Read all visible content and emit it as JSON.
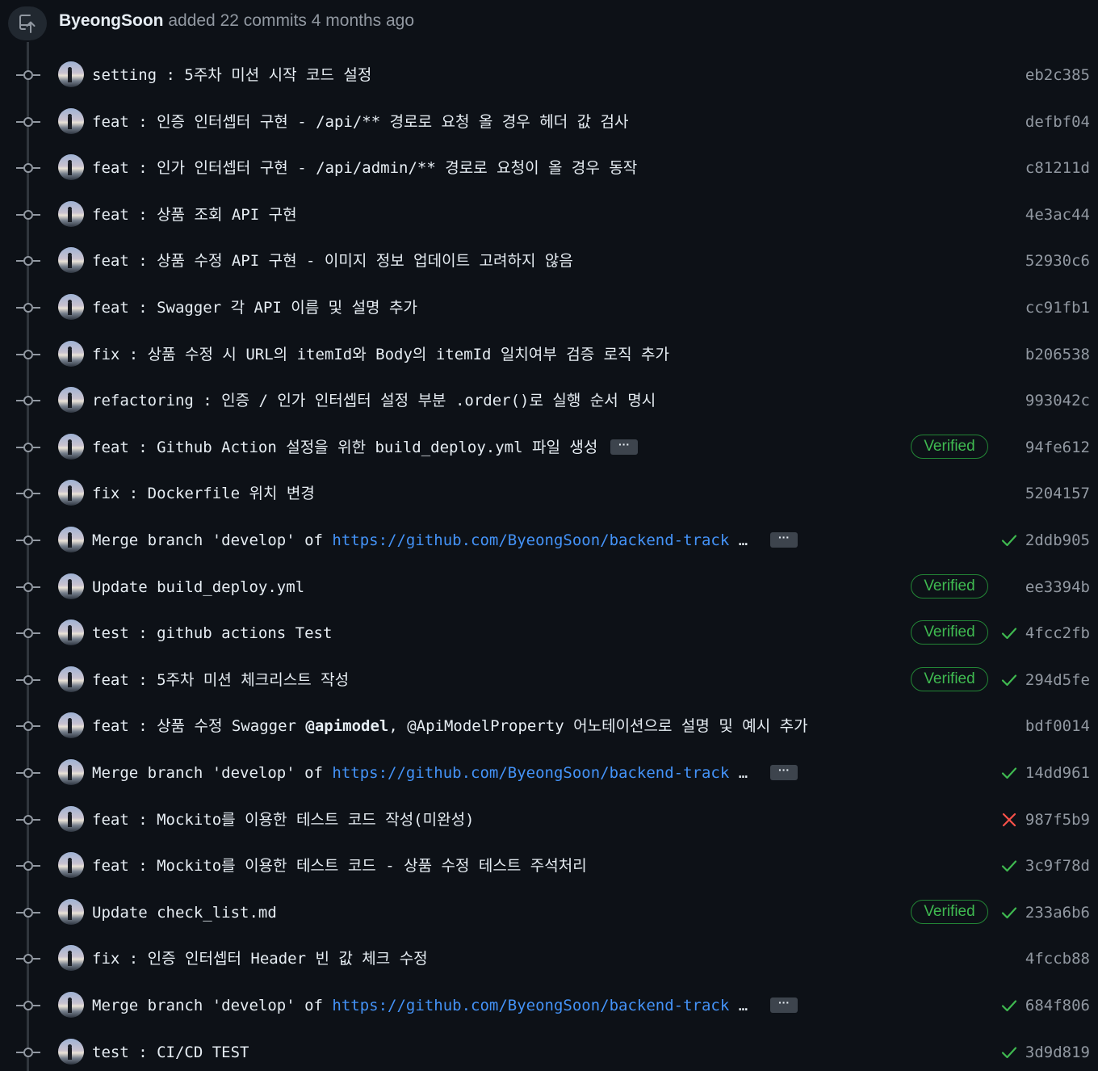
{
  "header": {
    "author": "ByeongSoon",
    "action_text": "added 22 commits 4 months ago"
  },
  "commits": [
    {
      "message": "setting : 5주차 미션 시작 코드 설정",
      "sha": "eb2c385",
      "verified": false,
      "status": "none"
    },
    {
      "message": "feat : 인증 인터셉터 구현 - /api/** 경로로 요청 올 경우 헤더 값 검사",
      "sha": "defbf04",
      "verified": false,
      "status": "none"
    },
    {
      "message": "feat : 인가 인터셉터 구현 - /api/admin/** 경로로 요청이 올 경우 동작",
      "sha": "c81211d",
      "verified": false,
      "status": "none"
    },
    {
      "message": "feat : 상품 조회 API 구현",
      "sha": "4e3ac44",
      "verified": false,
      "status": "none"
    },
    {
      "message": "feat : 상품 수정 API 구현 - 이미지 정보 업데이트 고려하지 않음",
      "sha": "52930c6",
      "verified": false,
      "status": "none"
    },
    {
      "message": "feat : Swagger 각 API 이름 및 설명 추가",
      "sha": "cc91fb1",
      "verified": false,
      "status": "none"
    },
    {
      "message": "fix : 상품 수정 시 URL의 itemId와 Body의 itemId 일치여부 검증 로직 추가",
      "sha": "b206538",
      "verified": false,
      "status": "none"
    },
    {
      "message": "refactoring : 인증 / 인가 인터셉터 설정 부분 .order()로 실행 순서 명시",
      "sha": "993042c",
      "verified": false,
      "status": "none"
    },
    {
      "message": "feat : Github Action 설정을 위한 build_deploy.yml 파일 생성",
      "sha": "94fe612",
      "verified": true,
      "status": "none",
      "has_ellipsis": true
    },
    {
      "message": "fix : Dockerfile 위치 변경",
      "sha": "5204157",
      "verified": false,
      "status": "none"
    },
    {
      "message_prefix": "Merge branch 'develop' of ",
      "message_link": "https://github.com/ByeongSoon/backend-track",
      "message_suffix": " …",
      "sha": "2ddb905",
      "verified": false,
      "status": "success",
      "has_ellipsis": true
    },
    {
      "message": "Update build_deploy.yml",
      "sha": "ee3394b",
      "verified": true,
      "status": "none"
    },
    {
      "message": "test : github actions Test",
      "sha": "4fcc2fb",
      "verified": true,
      "status": "success"
    },
    {
      "message": "feat : 5주차 미션 체크리스트 작성",
      "sha": "294d5fe",
      "verified": true,
      "status": "success"
    },
    {
      "message_prefix": "feat : 상품 수정 Swagger ",
      "message_mention": "@apimodel",
      "message_suffix": ", @ApiModelProperty 어노테이션으로 설명 및 예시 추가",
      "sha": "bdf0014",
      "verified": false,
      "status": "none"
    },
    {
      "message_prefix": "Merge branch 'develop' of ",
      "message_link": "https://github.com/ByeongSoon/backend-track",
      "message_suffix": " …",
      "sha": "14dd961",
      "verified": false,
      "status": "success",
      "has_ellipsis": true
    },
    {
      "message": "feat : Mockito를 이용한 테스트 코드 작성(미완성)",
      "sha": "987f5b9",
      "verified": false,
      "status": "failure"
    },
    {
      "message": "feat : Mockito를 이용한 테스트 코드 - 상품 수정 테스트 주석처리",
      "sha": "3c9f78d",
      "verified": false,
      "status": "success"
    },
    {
      "message": "Update check_list.md",
      "sha": "233a6b6",
      "verified": true,
      "status": "success"
    },
    {
      "message": "fix : 인증 인터셉터 Header 빈 값 체크 수정",
      "sha": "4fccb88",
      "verified": false,
      "status": "none"
    },
    {
      "message_prefix": "Merge branch 'develop' of ",
      "message_link": "https://github.com/ByeongSoon/backend-track",
      "message_suffix": " …",
      "sha": "684f806",
      "verified": false,
      "status": "success",
      "has_ellipsis": true
    },
    {
      "message": "test : CI/CD TEST",
      "sha": "3d9d819",
      "verified": false,
      "status": "success"
    }
  ],
  "labels": {
    "verified": "Verified",
    "ellipsis": "···"
  },
  "colors": {
    "background": "#0d1117",
    "success": "#3fb950",
    "failure": "#f85149",
    "link": "#4493f8",
    "muted": "#9198a1"
  },
  "icons": {
    "header": "push-icon",
    "commit": "commit-node-icon",
    "success": "check-icon",
    "failure": "x-icon"
  }
}
